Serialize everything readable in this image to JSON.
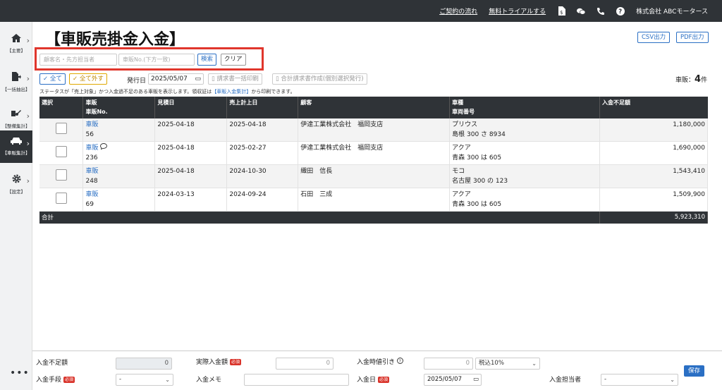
{
  "topbar": {
    "contract_flow": "ご契約の流れ",
    "free_trial": "無料トライアルする",
    "company": "株式会社 ABCモータース"
  },
  "sidebar": {
    "items": [
      {
        "label": "【主要】",
        "icon": "home-icon"
      },
      {
        "label": "【一括抽出】",
        "icon": "export-icon"
      },
      {
        "label": "【整備集計】",
        "icon": "wrench-icon"
      },
      {
        "label": "【車販集計】",
        "icon": "car-icon"
      },
      {
        "label": "【設定】",
        "icon": "gear-icon"
      }
    ],
    "more": "•••"
  },
  "page": {
    "title": "【車販売掛金入金】",
    "csv_label": "CSV出力",
    "pdf_label": "PDF出力"
  },
  "search": {
    "customer_placeholder": "顧客名・先方担当者",
    "sale_no_placeholder": "車販No.(下方一致)",
    "search_label": "検索",
    "clear_label": "クリア"
  },
  "toolbar": {
    "select_all": "✓ 全て",
    "deselect_all": "✓ 全て外す",
    "issue_date_label": "発行日",
    "issue_date": "2025/05/07",
    "bulk_invoice": "請求書一括印刷",
    "combined_invoice": "合計請求書作成(個別選択発行)",
    "count_prefix": "車販：",
    "count_value": "4",
    "count_suffix": "件",
    "note_a": "ステータスが「売上対象」かつ入金過不足のある車販を表示します。領収証は",
    "note_link": "【車販入金集計】",
    "note_b": "から印刷できます。"
  },
  "table": {
    "headers": {
      "select": "選択",
      "sale": "車販",
      "sale_no": "車販No.",
      "estimate_date": "見積日",
      "sales_date": "売上計上日",
      "customer": "顧客",
      "model": "車種",
      "plate": "車両番号",
      "shortage": "入金不足額"
    },
    "rows": [
      {
        "link": "車販",
        "no": "56",
        "estimate_date": "2025-04-18",
        "sales_date": "2025-04-18",
        "customer": "伊達工業株式会社　福岡支店",
        "model": "プリウス",
        "plate": "島根 300 さ 8934",
        "shortage": "1,180,000",
        "comment": false
      },
      {
        "link": "車販",
        "no": "236",
        "estimate_date": "2025-04-18",
        "sales_date": "2025-02-27",
        "customer": "伊達工業株式会社　福岡支店",
        "model": "アクア",
        "plate": "青森 300 は 605",
        "shortage": "1,690,000",
        "comment": true
      },
      {
        "link": "車販",
        "no": "248",
        "estimate_date": "2025-04-18",
        "sales_date": "2024-10-30",
        "customer": "織田　信長",
        "model": "モコ",
        "plate": "名古屋 300 の 123",
        "shortage": "1,543,410",
        "comment": false
      },
      {
        "link": "車販",
        "no": "69",
        "estimate_date": "2024-03-13",
        "sales_date": "2024-09-24",
        "customer": "石田　三成",
        "model": "アクア",
        "plate": "青森 300 は 605",
        "shortage": "1,509,900",
        "comment": false
      }
    ],
    "total_label": "合計",
    "total_value": "5,923,310"
  },
  "form": {
    "shortage_label": "入金不足額",
    "shortage_value": "0",
    "actual_label": "実際入金額",
    "actual_placeholder": "0",
    "discount_label": "入金時値引き",
    "discount_placeholder": "0",
    "tax_option": "税込10%",
    "method_label": "入金手段",
    "method_value": "-",
    "memo_label": "入金メモ",
    "date_label": "入金日",
    "date_value": "2025/05/07",
    "staff_label": "入金担当者",
    "staff_value": "-",
    "required": "必須",
    "save_label": "保存"
  },
  "colors": {
    "dark": "#2f3337",
    "accent": "#2a6fc4",
    "highlight": "#e0362c",
    "required": "#d9342b"
  }
}
